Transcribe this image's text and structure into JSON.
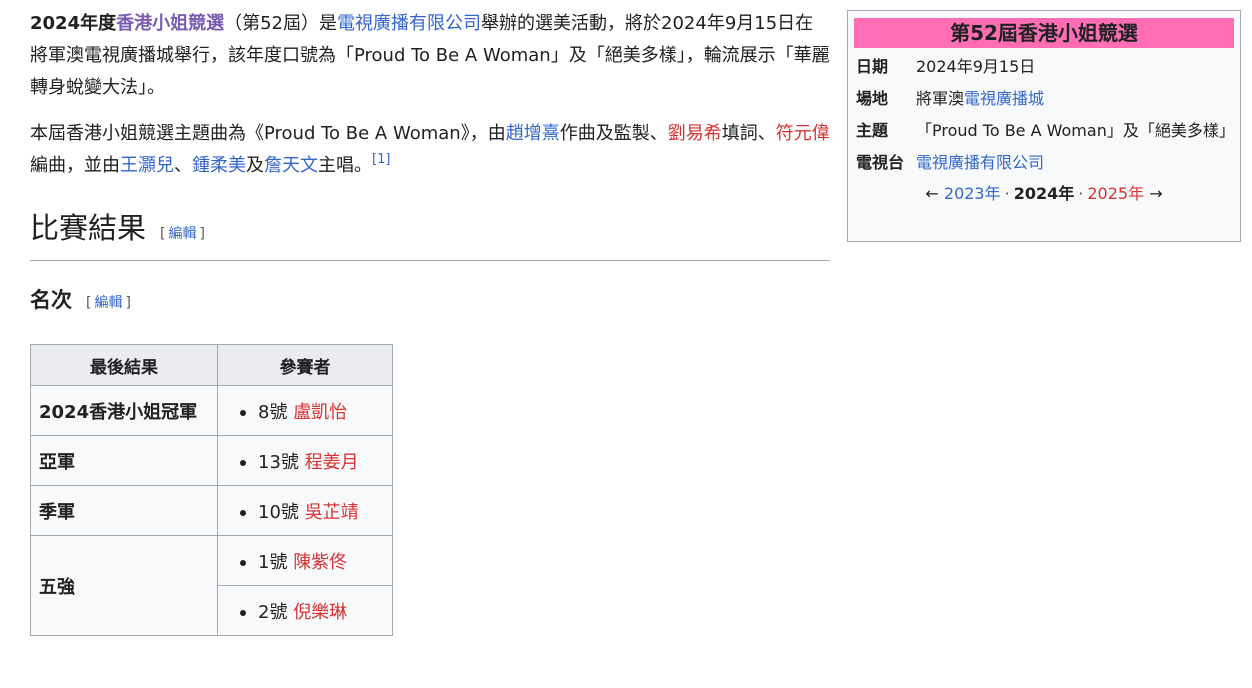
{
  "intro": {
    "p1": {
      "subject": "2024年度",
      "subject_link": "香港小姐競選",
      "text1": "（第52屆）是",
      "org_link": "電視廣播有限公司",
      "text2": "舉辦的選美活動，將於2024年9月15日在將軍澳電視廣播城舉行，該年度口號為「Proud To Be A Woman」及「絕美多樣」，輪流展示「華麗轉身蛻變大法」。"
    },
    "p2": {
      "text1": "本屆香港小姐競選主題曲為《Proud To Be A Woman》，由",
      "composer": "趙增熹",
      "text2": "作曲及監製、",
      "lyricist": "劉易希",
      "text3": "填詞、",
      "arranger": "符元偉",
      "text4": "編曲，並由",
      "singer1": "王灝兒",
      "sep1": "、",
      "singer2": "鍾柔美",
      "and": "及",
      "singer3": "詹天文",
      "text5": "主唱。",
      "ref": "[1]"
    }
  },
  "section": {
    "heading": "比賽結果",
    "edit_open": "[",
    "edit_label": "編輯",
    "edit_close": "]"
  },
  "subsection": {
    "heading": "名次",
    "edit_open": "[",
    "edit_label": "編輯",
    "edit_close": "]"
  },
  "table": {
    "headers": [
      "最後結果",
      "參賽者"
    ],
    "rows": [
      {
        "rank": "2024香港小姐冠軍",
        "entries": [
          {
            "number": "8號",
            "name": "盧凱怡"
          }
        ]
      },
      {
        "rank": "亞軍",
        "entries": [
          {
            "number": "13號",
            "name": "程姜月"
          }
        ]
      },
      {
        "rank": "季軍",
        "entries": [
          {
            "number": "10號",
            "name": "吳芷靖"
          }
        ]
      },
      {
        "rank": "五強",
        "entries": [
          {
            "number": "1號",
            "name": "陳紫佟"
          },
          {
            "number": "2號",
            "name": "倪樂琳"
          }
        ]
      }
    ]
  },
  "infobox": {
    "title": "第52屆香港小姐競選",
    "date_label": "日期",
    "date_value": "2024年9月15日",
    "venue_label": "場地",
    "venue_prefix": "將軍澳",
    "venue_link": "電視廣播城",
    "theme_label": "主題",
    "theme_value": "「Proud To Be A Woman」及「絕美多樣」",
    "tv_label": "電視台",
    "tv_link": "電視廣播有限公司",
    "nav_prev_arrow": "←",
    "nav_prev": "2023年",
    "nav_sep": "·",
    "nav_current": "2024年",
    "nav_next": "2025年",
    "nav_next_arrow": "→"
  },
  "colors": {
    "link": "#3366cc",
    "visited_link": "#795cb2",
    "missing_link": "#d73333",
    "infobox_title_bg": "#ff6eb4"
  }
}
